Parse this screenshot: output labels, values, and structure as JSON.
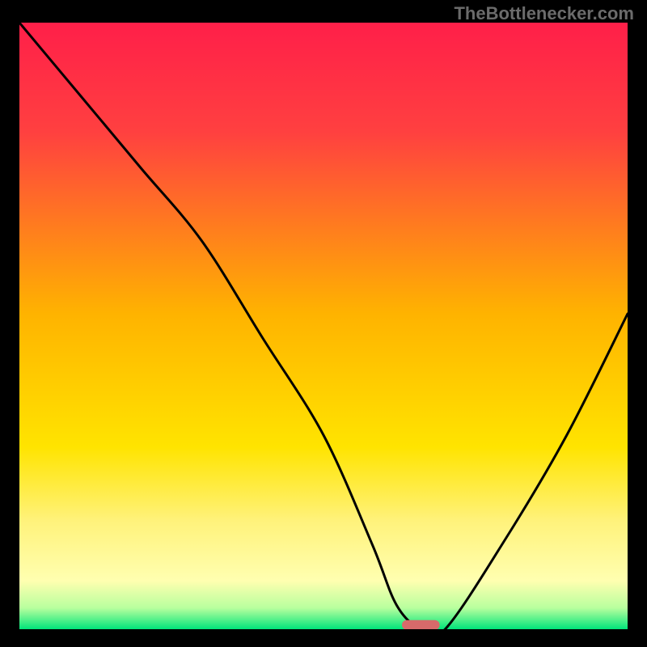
{
  "watermark": "TheBottlenecker.com",
  "chart_data": {
    "type": "line",
    "title": "",
    "xlabel": "",
    "ylabel": "",
    "xlim": [
      0,
      100
    ],
    "ylim": [
      0,
      100
    ],
    "background_gradient": {
      "stops": [
        {
          "offset": 0.0,
          "color": "#ff1f49"
        },
        {
          "offset": 0.18,
          "color": "#ff4040"
        },
        {
          "offset": 0.48,
          "color": "#ffb300"
        },
        {
          "offset": 0.7,
          "color": "#ffe400"
        },
        {
          "offset": 0.82,
          "color": "#fff27a"
        },
        {
          "offset": 0.92,
          "color": "#ffffb0"
        },
        {
          "offset": 0.965,
          "color": "#b8ff9e"
        },
        {
          "offset": 1.0,
          "color": "#00e47a"
        }
      ]
    },
    "series": [
      {
        "name": "bottleneck-curve",
        "x": [
          0,
          10,
          20,
          30,
          40,
          50,
          58,
          62,
          66,
          70,
          80,
          90,
          100
        ],
        "y": [
          100,
          88,
          76,
          64,
          48,
          32,
          14,
          4,
          0,
          0,
          15,
          32,
          52
        ]
      }
    ],
    "marker": {
      "name": "highlight-pill",
      "x": 66,
      "y": 0.7,
      "width": 6.2,
      "height": 1.6,
      "color": "#d76a6a"
    }
  }
}
